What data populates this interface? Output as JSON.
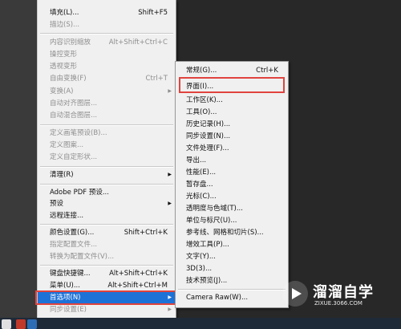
{
  "main_menu": {
    "items": [
      {
        "label": "填充(L)...",
        "shortcut": "Shift+F5",
        "disabled": false
      },
      {
        "label": "描边(S)...",
        "shortcut": "",
        "disabled": true
      },
      {
        "label": "内容识别缩放",
        "shortcut": "Alt+Shift+Ctrl+C",
        "disabled": true
      },
      {
        "label": "操控变形",
        "shortcut": "",
        "disabled": true
      },
      {
        "label": "透视变形",
        "shortcut": "",
        "disabled": true
      },
      {
        "label": "自由变换(F)",
        "shortcut": "Ctrl+T",
        "disabled": true
      },
      {
        "label": "变换(A)",
        "shortcut": "",
        "disabled": true,
        "submenu": true
      },
      {
        "label": "自动对齐图层...",
        "shortcut": "",
        "disabled": true
      },
      {
        "label": "自动混合图层...",
        "shortcut": "",
        "disabled": true
      },
      {
        "label": "定义画笔预设(B)...",
        "shortcut": "",
        "disabled": true
      },
      {
        "label": "定义图案...",
        "shortcut": "",
        "disabled": true
      },
      {
        "label": "定义自定形状...",
        "shortcut": "",
        "disabled": true
      },
      {
        "label": "清理(R)",
        "shortcut": "",
        "disabled": false,
        "submenu": true
      },
      {
        "label": "Adobe PDF 预设...",
        "shortcut": "",
        "disabled": false
      },
      {
        "label": "预设",
        "shortcut": "",
        "disabled": false,
        "submenu": true
      },
      {
        "label": "远程连接...",
        "shortcut": "",
        "disabled": false
      },
      {
        "label": "颜色设置(G)...",
        "shortcut": "Shift+Ctrl+K",
        "disabled": false
      },
      {
        "label": "指定配置文件...",
        "shortcut": "",
        "disabled": true
      },
      {
        "label": "转换为配置文件(V)...",
        "shortcut": "",
        "disabled": true
      },
      {
        "label": "键盘快捷键...",
        "shortcut": "Alt+Shift+Ctrl+K",
        "disabled": false
      },
      {
        "label": "菜单(U)...",
        "shortcut": "Alt+Shift+Ctrl+M",
        "disabled": false
      },
      {
        "label": "首选项(N)",
        "shortcut": "",
        "disabled": false,
        "submenu": true,
        "highlighted": true
      },
      {
        "label": "同步设置(E)",
        "shortcut": "",
        "disabled": true,
        "submenu": true
      }
    ]
  },
  "submenu": {
    "items": [
      {
        "label": "常规(G)...",
        "shortcut": "Ctrl+K"
      },
      {
        "label": "界面(I)...",
        "shortcut": "",
        "boxed": true
      },
      {
        "label": "工作区(K)...",
        "shortcut": ""
      },
      {
        "label": "工具(O)...",
        "shortcut": ""
      },
      {
        "label": "历史记录(H)...",
        "shortcut": ""
      },
      {
        "label": "同步设置(N)...",
        "shortcut": ""
      },
      {
        "label": "文件处理(F)...",
        "shortcut": ""
      },
      {
        "label": "导出...",
        "shortcut": ""
      },
      {
        "label": "性能(E)...",
        "shortcut": ""
      },
      {
        "label": "暂存盘...",
        "shortcut": ""
      },
      {
        "label": "光标(C)...",
        "shortcut": ""
      },
      {
        "label": "透明度与色域(T)...",
        "shortcut": ""
      },
      {
        "label": "单位与标尺(U)...",
        "shortcut": ""
      },
      {
        "label": "参考线、网格和切片(S)...",
        "shortcut": ""
      },
      {
        "label": "增效工具(P)...",
        "shortcut": ""
      },
      {
        "label": "文字(Y)...",
        "shortcut": ""
      },
      {
        "label": "3D(3)...",
        "shortcut": ""
      },
      {
        "label": "技术预览(J)...",
        "shortcut": ""
      },
      {
        "label": "Camera Raw(W)...",
        "shortcut": ""
      }
    ]
  },
  "watermark": {
    "title": "溜溜自学",
    "subtitle": "ZIXUE.3066.COM"
  },
  "colors": {
    "highlight": "#1d72d8",
    "annotation_box": "#e0433e"
  }
}
